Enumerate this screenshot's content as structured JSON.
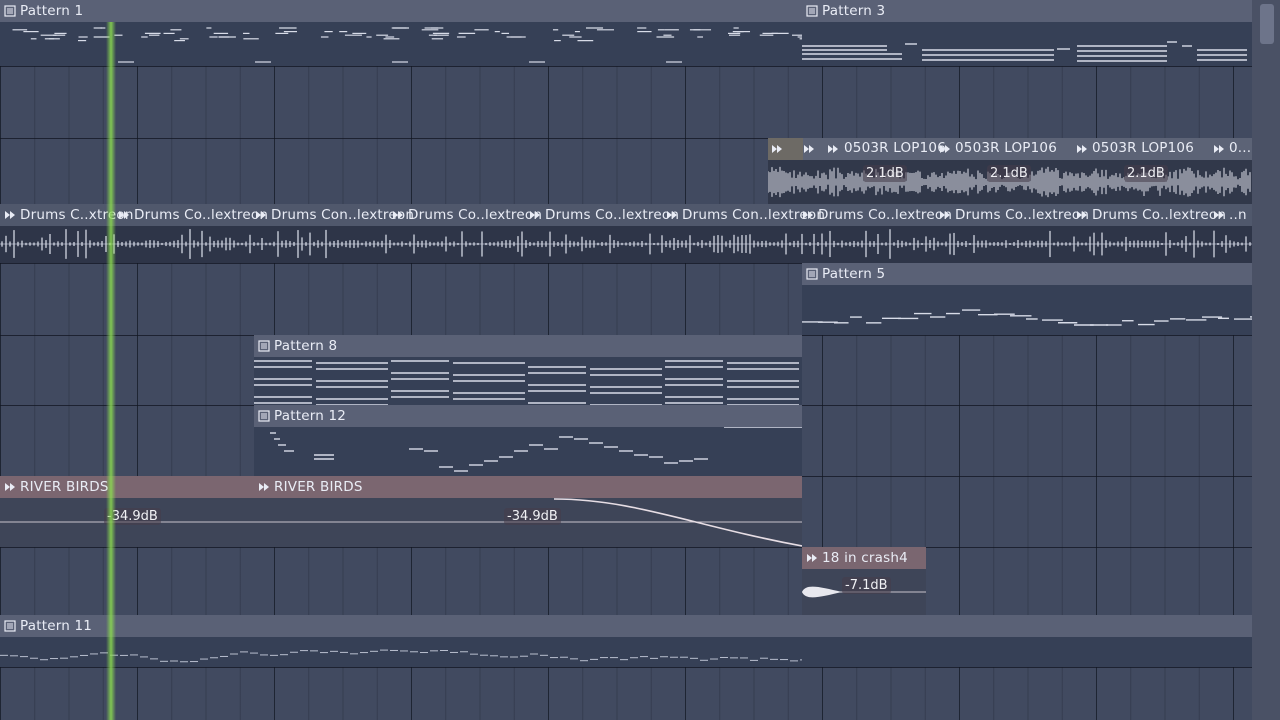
{
  "clips": {
    "pattern1": "Pattern 1",
    "pattern3": "Pattern 3",
    "pattern5": "Pattern 5",
    "pattern8": "Pattern 8",
    "pattern12": "Pattern 12",
    "pattern11": "Pattern 11",
    "loop_label": "0503R LOP106",
    "loop_label_trunc": "0...",
    "loop_db": "2.1dB",
    "drums_labels": [
      "Drums C..xtreon",
      "Drums Co..lextreon",
      "Drums Con..lextreon",
      "Drums Co..lextreon",
      "Drums Co..lextreon",
      "Drums Con..lextreon",
      "Drums Co..lextreon",
      "Drums Co..lextreon",
      "Drums Co..lextreon",
      "..n"
    ],
    "birds1": "RIVER BIRDS",
    "birds2": "RIVER BIRDS",
    "birds_db": "-34.9dB",
    "crash": "18 in crash4",
    "crash_db": "-7.1dB"
  },
  "colors": {
    "playhead": "#8cdc50",
    "track_bg": "#414a60"
  }
}
